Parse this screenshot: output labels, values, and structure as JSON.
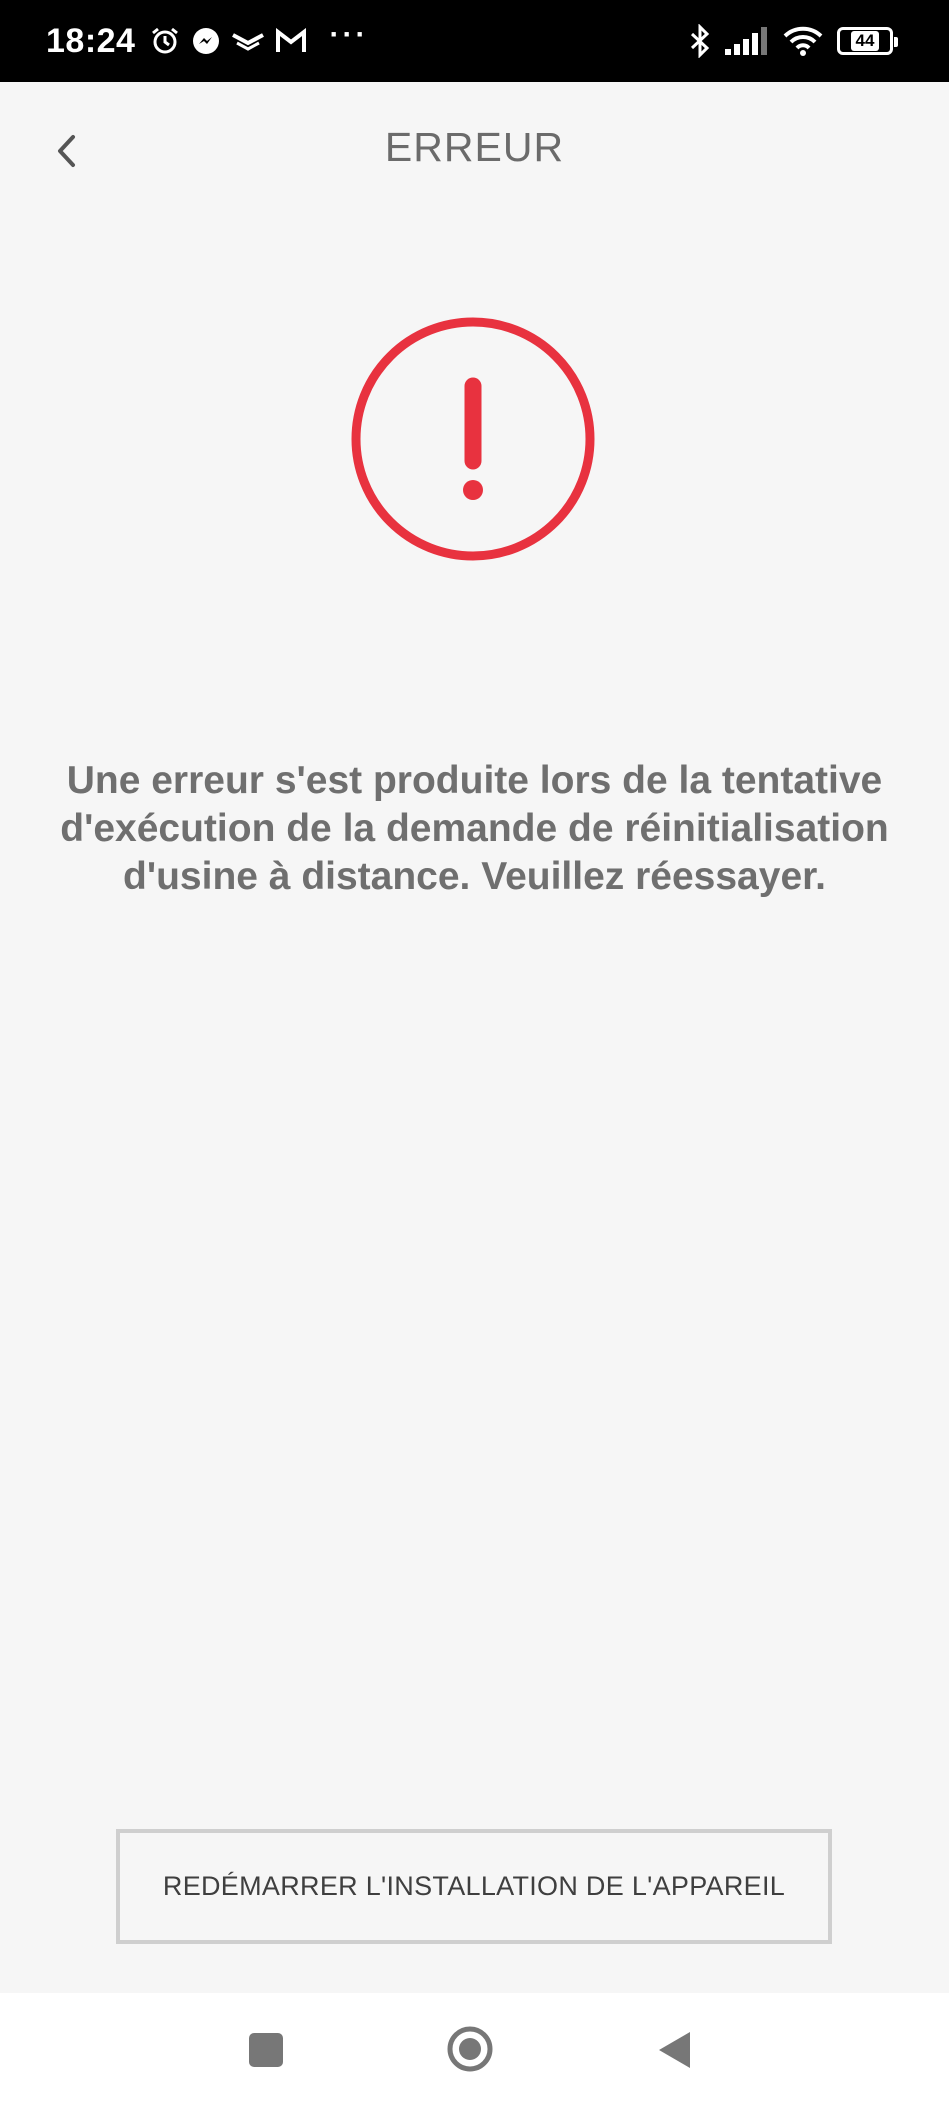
{
  "status_bar": {
    "time": "18:24",
    "left_icons": [
      "alarm-icon",
      "messenger-icon",
      "notification-icon",
      "gmail-icon"
    ],
    "more": "···",
    "right_icons": [
      "bluetooth-icon",
      "signal-icon",
      "wifi-icon"
    ],
    "battery_level": "44"
  },
  "header": {
    "title": "ERREUR",
    "back_icon": "chevron-left-icon"
  },
  "error": {
    "icon": "exclamation-circle-icon",
    "color": "#e8323f",
    "message": "Une erreur s'est produite lors de la tentative d'exécution de la demande de réinitialisation d'usine à distance. Veuillez réessayer."
  },
  "actions": {
    "restart_label": "REDÉMARRER L'INSTALLATION DE L'APPAREIL"
  },
  "nav_bar": {
    "icons": [
      "recents-icon",
      "home-icon",
      "back-icon"
    ]
  }
}
